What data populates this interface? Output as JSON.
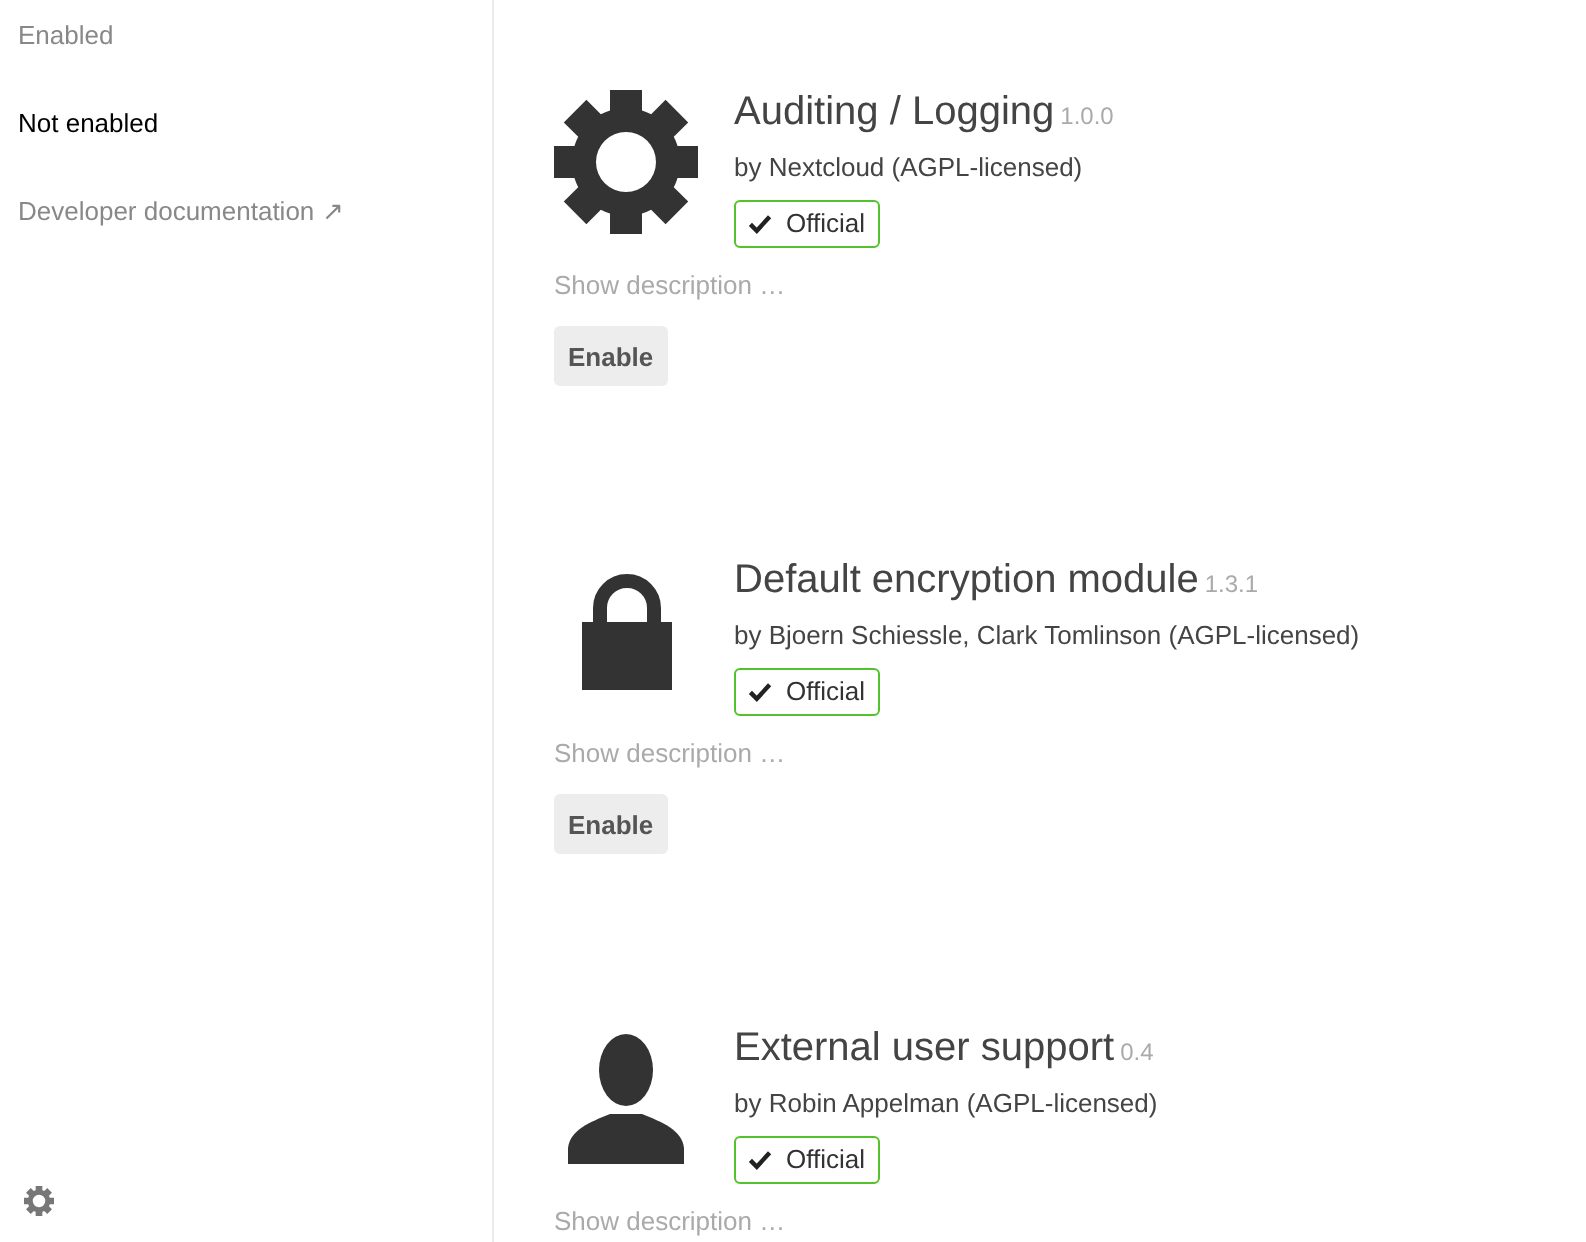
{
  "sidebar": {
    "items": [
      {
        "label": "Enabled",
        "selected": false
      },
      {
        "label": "Not enabled",
        "selected": true
      },
      {
        "label": "Developer documentation ↗",
        "selected": false
      }
    ]
  },
  "apps": [
    {
      "name": "Auditing / Logging",
      "version": "1.0.0",
      "author": "by Nextcloud (AGPL-licensed)",
      "badge": "Official",
      "description_toggle": "Show description …",
      "button": "Enable"
    },
    {
      "name": "Default encryption module",
      "version": "1.3.1",
      "author": "by Bjoern Schiessle, Clark Tomlinson (AGPL-licensed)",
      "badge": "Official",
      "description_toggle": "Show description …",
      "button": "Enable"
    },
    {
      "name": "External user support",
      "version": "0.4",
      "author": "by Robin Appelman (AGPL-licensed)",
      "badge": "Official",
      "description_toggle": "Show description …"
    }
  ]
}
